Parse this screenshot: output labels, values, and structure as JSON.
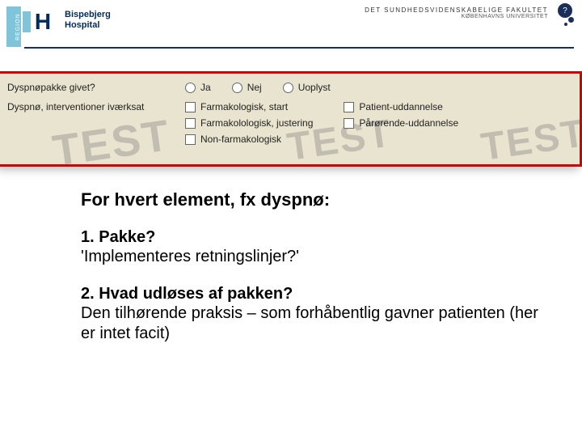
{
  "header": {
    "region": "REGION",
    "hospital_line1": "Bispebjerg",
    "hospital_line2": "Hospital",
    "faculty_title": "DET SUNDHEDSVIDENSKABELIGE FAKULTET",
    "faculty_sub": "KØBENHAVNS UNIVERSITET",
    "seal_glyph": "?"
  },
  "panel": {
    "watermark": "TEST",
    "q1": {
      "label": "Dyspnøpakke givet?",
      "options": [
        "Ja",
        "Nej",
        "Uoplyst"
      ]
    },
    "q2": {
      "label": "Dyspnø, interventioner iværksat",
      "col1": [
        "Farmakologisk, start",
        "Farmakolologisk, justering",
        "Non-farmakologisk"
      ],
      "col2": [
        "Patient-uddannelse",
        "Pårørende-uddannelse"
      ]
    }
  },
  "content": {
    "heading": "For hvert element, fx dyspnø:",
    "item1_head": "1. Pakke?",
    "item1_body": "'Implementeres retningslinjer?'",
    "item2_head": "2. Hvad udløses af pakken?",
    "item2_body": "Den tilhørende praksis – som forhåbentlig gavner patienten (her er intet facit)"
  }
}
